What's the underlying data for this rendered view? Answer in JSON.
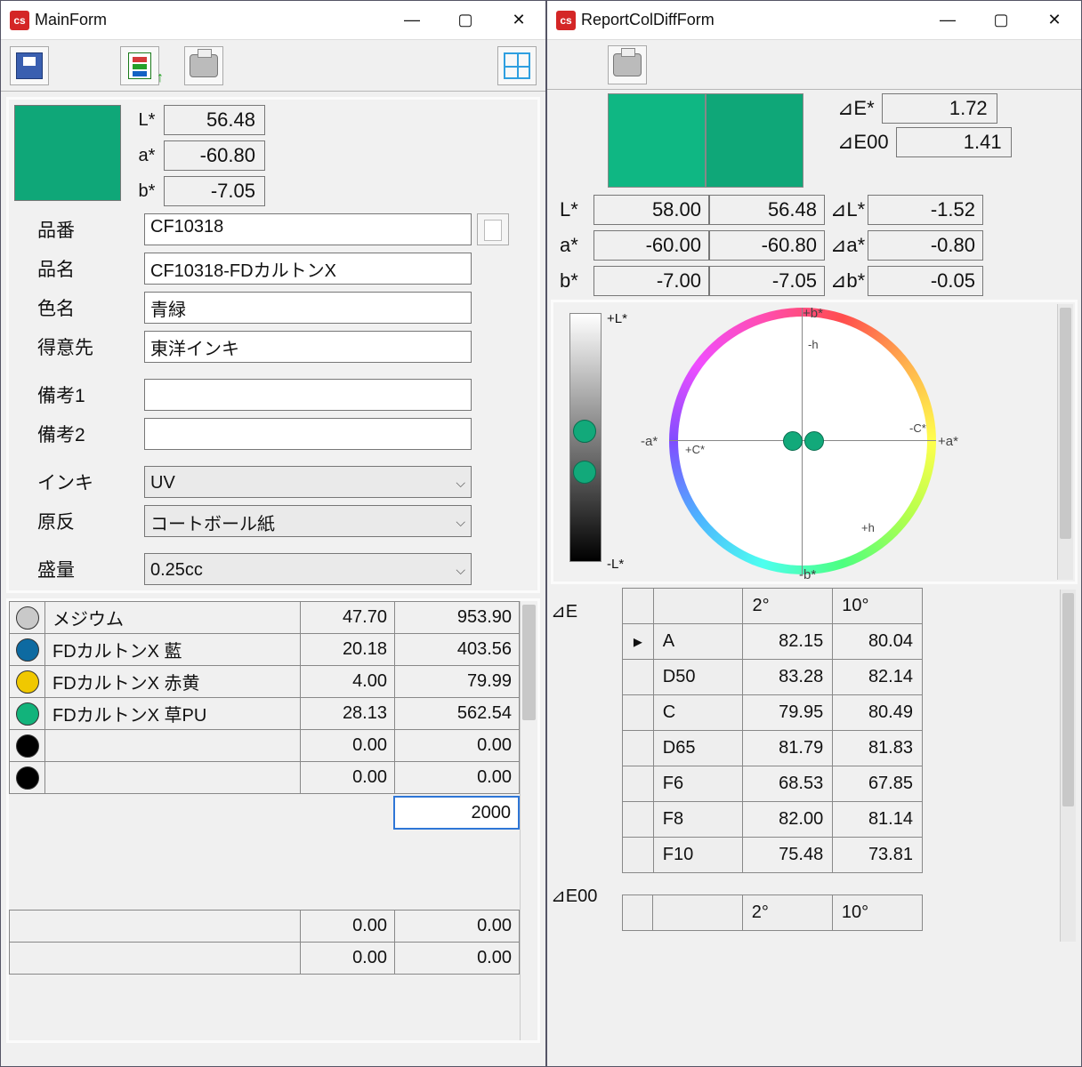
{
  "main": {
    "title": "MainForm",
    "swatch_color": "#0fa778",
    "lab": {
      "L": "56.48",
      "a": "-60.80",
      "b": "-7.05"
    },
    "fields": {
      "partno_label": "品番",
      "partno": "CF10318",
      "partname_label": "品名",
      "partname": "CF10318-FDカルトンX",
      "colorname_label": "色名",
      "colorname": "青緑",
      "customer_label": "得意先",
      "customer": "東洋インキ",
      "note1_label": "備考1",
      "note1": "",
      "note2_label": "備考2",
      "note2": "",
      "ink_label": "インキ",
      "ink": "UV",
      "base_label": "原反",
      "base": "コートボール紙",
      "vol_label": "盛量",
      "vol": "0.25cc"
    },
    "materials": [
      {
        "swatch": "#c9c9c9",
        "name": "メジウム",
        "v1": "47.70",
        "v2": "953.90"
      },
      {
        "swatch": "#0d6aa1",
        "name": "FDカルトンX 藍",
        "v1": "20.18",
        "v2": "403.56"
      },
      {
        "swatch": "#f0c800",
        "name": "FDカルトンX 赤黄",
        "v1": "4.00",
        "v2": "79.99"
      },
      {
        "swatch": "#12b37b",
        "name": "FDカルトンX 草PU",
        "v1": "28.13",
        "v2": "562.54"
      },
      {
        "swatch": "#000000",
        "name": "",
        "v1": "0.00",
        "v2": "0.00"
      },
      {
        "swatch": "#000000",
        "name": "",
        "v1": "0.00",
        "v2": "0.00"
      }
    ],
    "total": "2000",
    "bottom": [
      {
        "name": "",
        "v1": "0.00",
        "v2": "0.00"
      },
      {
        "name": "",
        "v1": "0.00",
        "v2": "0.00"
      }
    ]
  },
  "report": {
    "title": "ReportColDiffForm",
    "sw1": "#0fb783",
    "sw2": "#0fa778",
    "dE": "1.72",
    "dE00": "1.41",
    "L1": "58.00",
    "L2": "56.48",
    "dL": "-1.52",
    "a1": "-60.00",
    "a2": "-60.80",
    "da": "-0.80",
    "b1": "-7.00",
    "b2": "-7.05",
    "db": "-0.05",
    "diag_labels": {
      "pL": "+L*",
      "mL": "-L*",
      "pb": "+b*",
      "mb": "-b*",
      "pa": "+a*",
      "ma": "-a*",
      "pc": "+C*",
      "mc": "-C*",
      "ph": "+h",
      "mh": "-h"
    },
    "de_label": "⊿E",
    "de00_label": "⊿E00",
    "hdr_2": "2°",
    "hdr_10": "10°",
    "rows": [
      {
        "name": "A",
        "v2": "82.15",
        "v10": "80.04",
        "mark": "▸"
      },
      {
        "name": "D50",
        "v2": "83.28",
        "v10": "82.14",
        "mark": ""
      },
      {
        "name": "C",
        "v2": "79.95",
        "v10": "80.49",
        "mark": ""
      },
      {
        "name": "D65",
        "v2": "81.79",
        "v10": "81.83",
        "mark": ""
      },
      {
        "name": "F6",
        "v2": "68.53",
        "v10": "67.85",
        "mark": ""
      },
      {
        "name": "F8",
        "v2": "82.00",
        "v10": "81.14",
        "mark": ""
      },
      {
        "name": "F10",
        "v2": "75.48",
        "v10": "73.81",
        "mark": ""
      }
    ]
  }
}
